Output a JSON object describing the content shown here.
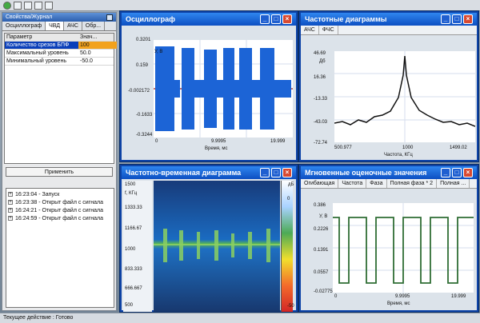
{
  "left": {
    "title": "Свойства/Журнал",
    "tabs": [
      "Осциллограф",
      "ЧВД",
      "АЧС",
      "Обр..."
    ],
    "headers": [
      "Параметр",
      "Знач..."
    ],
    "rows": [
      {
        "name": "Количество срезов БПФ",
        "value": "100"
      },
      {
        "name": "Максимальный уровень",
        "value": "50.0"
      },
      {
        "name": "Минимальный уровень",
        "value": "-50.0"
      }
    ],
    "apply": "Применить",
    "log": [
      "16:23:04 - Запуск",
      "16:23:38 - Открыт файл с сигнала",
      "16:24:21 - Открыт файл с сигнала",
      "16:24:59 - Открыт файл с сигнала"
    ]
  },
  "osc": {
    "title": "Осциллограф",
    "ylabels": [
      "0.3201",
      "0.159",
      "-0.002172",
      "-0.1633",
      "-0.3244"
    ],
    "xlabels": [
      "0",
      "9.9995",
      "19.999"
    ],
    "xname": "Время, мс",
    "yname": "У, В"
  },
  "freq": {
    "title": "Частотные диаграммы",
    "tabs": [
      "АЧС",
      "ФЧС"
    ],
    "ylabels": [
      "46.69",
      "16.36",
      "-13.33",
      "-43.03",
      "-72.74"
    ],
    "xlabels": [
      "500.977",
      "1000",
      "1499.02"
    ],
    "xname": "Частота, КГц",
    "yname": "Дб"
  },
  "spec": {
    "title": "Частотно-временная диаграмма",
    "ylabels": [
      "1500",
      "1333.33",
      "1166.67",
      "1000",
      "833.333",
      "666.667",
      "500"
    ],
    "yname": "f, КГц",
    "colorbar": [
      "дБ",
      "0",
      "-50"
    ]
  },
  "inst": {
    "title": "Мгновенные оценочные значения",
    "tabs": [
      "Огибающая",
      "Частота",
      "Фаза",
      "Полная фаза * 2",
      "Полная ..."
    ],
    "ylabels": [
      "0.386",
      "0.2226",
      "0.1391",
      "0.0557",
      "-0.02775"
    ],
    "xlabels": [
      "0",
      "9.9995",
      "19.999"
    ],
    "xname": "Время, мс",
    "yname": "У, В"
  },
  "status": "Текущее действие : Готово",
  "colors": {
    "titlebar": "#0d4fc2",
    "signal": "#1c64d6",
    "envelope": "#2f6d34"
  }
}
